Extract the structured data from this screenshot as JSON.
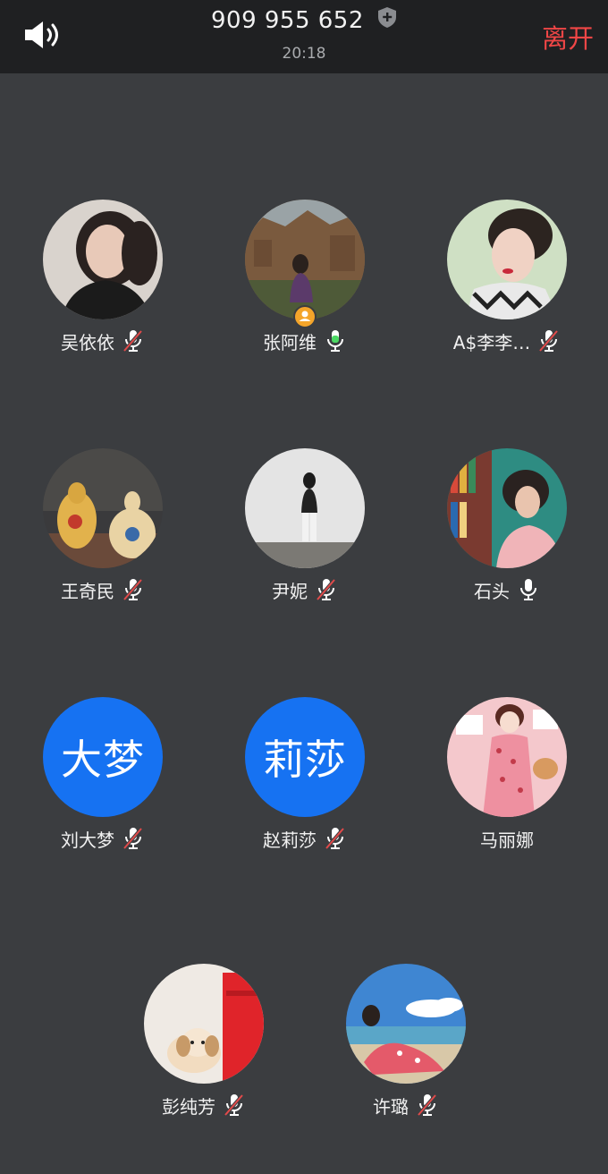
{
  "header": {
    "meeting_id": "909 955 652",
    "time": "20:18",
    "leave_label": "离开",
    "icons": {
      "speaker": "speaker-icon",
      "security": "shield-plus-icon"
    }
  },
  "colors": {
    "background": "#3b3d40",
    "topbar": "#1f2022",
    "leave": "#f04646",
    "initials_bg": "#1672f2",
    "mic_muted_slash": "#e14a4a",
    "mic_active": "#4cd964",
    "host_badge": "#f4a52a"
  },
  "participants": [
    {
      "name": "吴依依",
      "mic": "muted"
    },
    {
      "name": "张阿维",
      "mic": "speaking",
      "host": true
    },
    {
      "name": "A$李李…",
      "mic": "muted"
    },
    {
      "name": "王奇民",
      "mic": "muted"
    },
    {
      "name": "尹妮",
      "mic": "muted"
    },
    {
      "name": "石头",
      "mic": "on"
    },
    {
      "name": "刘大梦",
      "mic": "muted",
      "initials": "大梦"
    },
    {
      "name": "赵莉莎",
      "mic": "muted",
      "initials": "莉莎"
    },
    {
      "name": "马丽娜",
      "mic": "none"
    },
    {
      "name": "彭纯芳",
      "mic": "muted"
    },
    {
      "name": "许璐",
      "mic": "muted"
    }
  ]
}
